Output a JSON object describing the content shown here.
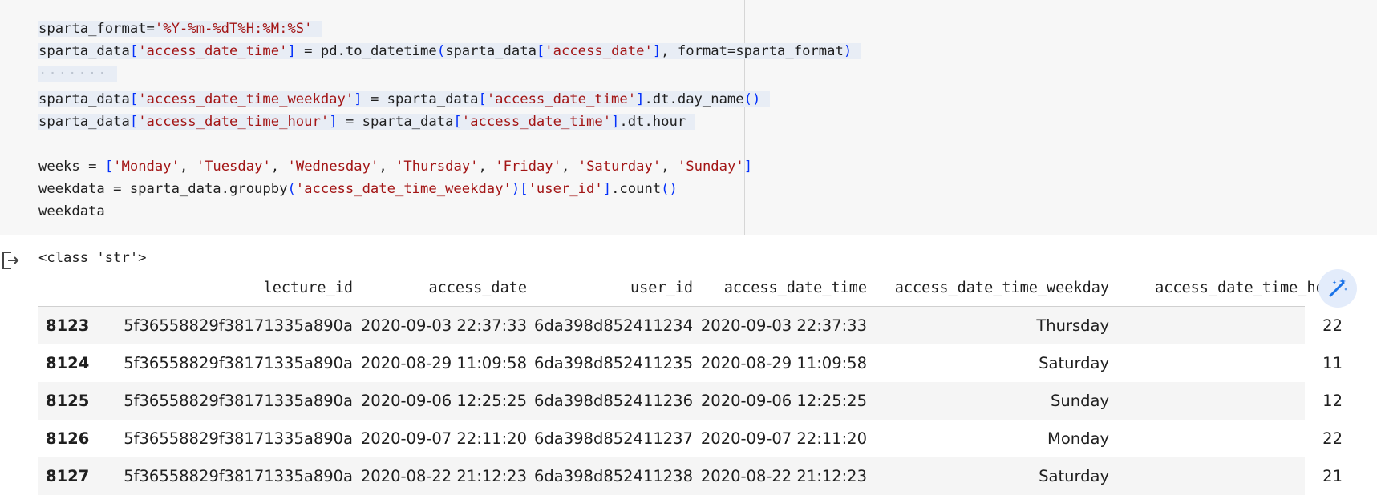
{
  "code_cell": {
    "lines": [
      {
        "segments": [
          {
            "t": "sparta_format=",
            "c": "plain"
          },
          {
            "t": "'%Y-%m-%dT%H:%M:%S'",
            "c": "str"
          }
        ]
      },
      {
        "segments": [
          {
            "t": "sparta_data",
            "c": "plain"
          },
          {
            "t": "[",
            "c": "br"
          },
          {
            "t": "'access_date_time'",
            "c": "str"
          },
          {
            "t": "]",
            "c": "br"
          },
          {
            "t": " = pd.to_datetime",
            "c": "plain"
          },
          {
            "t": "(",
            "c": "br"
          },
          {
            "t": "sparta_data",
            "c": "plain"
          },
          {
            "t": "[",
            "c": "br"
          },
          {
            "t": "'access_date'",
            "c": "str"
          },
          {
            "t": "]",
            "c": "br"
          },
          {
            "t": ", format=sparta_format",
            "c": "plain"
          },
          {
            "t": ")",
            "c": "br"
          }
        ]
      },
      {
        "segments": [
          {
            "t": "·······",
            "c": "dots"
          }
        ]
      },
      {
        "segments": [
          {
            "t": "sparta_data",
            "c": "plain"
          },
          {
            "t": "[",
            "c": "br"
          },
          {
            "t": "'access_date_time_weekday'",
            "c": "str"
          },
          {
            "t": "]",
            "c": "br"
          },
          {
            "t": " = sparta_data",
            "c": "plain"
          },
          {
            "t": "[",
            "c": "br"
          },
          {
            "t": "'access_date_time'",
            "c": "str"
          },
          {
            "t": "]",
            "c": "br"
          },
          {
            "t": ".dt.day_name",
            "c": "plain"
          },
          {
            "t": "()",
            "c": "br"
          }
        ]
      },
      {
        "segments": [
          {
            "t": "sparta_data",
            "c": "plain"
          },
          {
            "t": "[",
            "c": "br"
          },
          {
            "t": "'access_date_time_hour'",
            "c": "str"
          },
          {
            "t": "]",
            "c": "br"
          },
          {
            "t": " = sparta_data",
            "c": "plain"
          },
          {
            "t": "[",
            "c": "br"
          },
          {
            "t": "'access_date_time'",
            "c": "str"
          },
          {
            "t": "]",
            "c": "br"
          },
          {
            "t": ".dt.hour",
            "c": "plain"
          }
        ]
      },
      {
        "segments": []
      },
      {
        "segments": [
          {
            "t": "weeks = ",
            "c": "plain"
          },
          {
            "t": "[",
            "c": "br"
          },
          {
            "t": "'Monday'",
            "c": "str"
          },
          {
            "t": ", ",
            "c": "plain"
          },
          {
            "t": "'Tuesday'",
            "c": "str"
          },
          {
            "t": ", ",
            "c": "plain"
          },
          {
            "t": "'Wednesday'",
            "c": "str"
          },
          {
            "t": ", ",
            "c": "plain"
          },
          {
            "t": "'Thursday'",
            "c": "str"
          },
          {
            "t": ", ",
            "c": "plain"
          },
          {
            "t": "'Friday'",
            "c": "str"
          },
          {
            "t": ", ",
            "c": "plain"
          },
          {
            "t": "'Saturday'",
            "c": "str"
          },
          {
            "t": ", ",
            "c": "plain"
          },
          {
            "t": "'Sunday'",
            "c": "str"
          },
          {
            "t": "]",
            "c": "br"
          }
        ]
      },
      {
        "segments": [
          {
            "t": "weekdata = sparta_data.groupby",
            "c": "plain"
          },
          {
            "t": "(",
            "c": "br"
          },
          {
            "t": "'access_date_time_weekday'",
            "c": "str"
          },
          {
            "t": ")",
            "c": "br"
          },
          {
            "t": "[",
            "c": "br"
          },
          {
            "t": "'user_id'",
            "c": "str"
          },
          {
            "t": "]",
            "c": "br"
          },
          {
            "t": ".count",
            "c": "plain"
          },
          {
            "t": "()",
            "c": "br"
          }
        ]
      },
      {
        "segments": [
          {
            "t": "weekdata",
            "c": "plain"
          }
        ]
      }
    ]
  },
  "output": {
    "print_text": "<class 'str'>",
    "table": {
      "headers": [
        "lecture_id",
        "access_date",
        "user_id",
        "access_date_time",
        "access_date_time_weekday",
        "access_date_time_hour"
      ],
      "rows": [
        {
          "index": "8123",
          "cells": [
            "5f36558829f38171335a890a",
            "2020-09-03 22:37:33",
            "6da398d852411234",
            "2020-09-03 22:37:33",
            "Thursday",
            "22"
          ]
        },
        {
          "index": "8124",
          "cells": [
            "5f36558829f38171335a890a",
            "2020-08-29 11:09:58",
            "6da398d852411235",
            "2020-08-29 11:09:58",
            "Saturday",
            "11"
          ]
        },
        {
          "index": "8125",
          "cells": [
            "5f36558829f38171335a890a",
            "2020-09-06 12:25:25",
            "6da398d852411236",
            "2020-09-06 12:25:25",
            "Sunday",
            "12"
          ]
        },
        {
          "index": "8126",
          "cells": [
            "5f36558829f38171335a890a",
            "2020-09-07 22:11:20",
            "6da398d852411237",
            "2020-09-07 22:11:20",
            "Monday",
            "22"
          ]
        },
        {
          "index": "8127",
          "cells": [
            "5f36558829f38171335a890a",
            "2020-08-22 21:12:23",
            "6da398d852411238",
            "2020-08-22 21:12:23",
            "Saturday",
            "21"
          ]
        }
      ]
    }
  },
  "icons": {
    "output": "output-icon",
    "magic": "magic-wand-icon"
  },
  "colors": {
    "code_bg": "#f7f7f7",
    "string": "#a31515",
    "bracket": "#0431fa",
    "highlight": "#e8edf5",
    "magic_bg": "#e3ecfb",
    "magic_fg": "#1a73e8"
  }
}
